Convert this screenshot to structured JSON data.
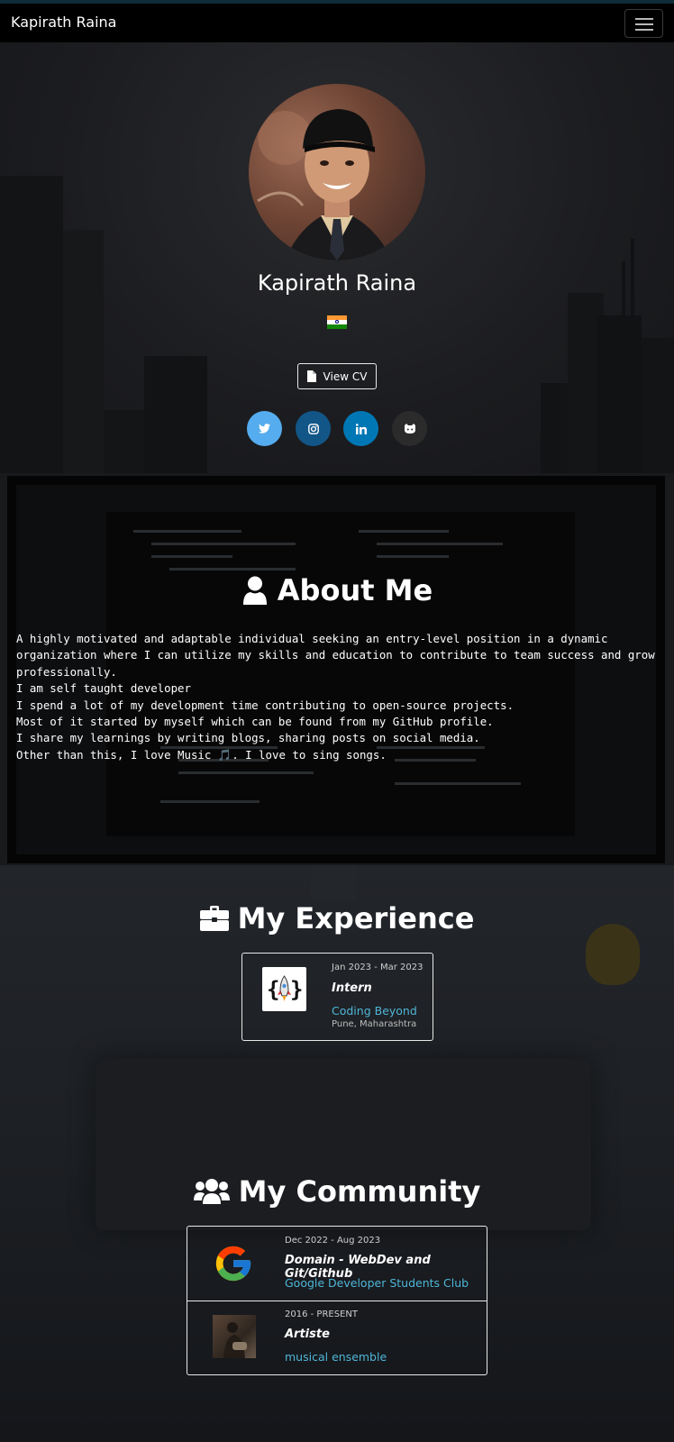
{
  "navbar": {
    "brand": "Kapirath Raina",
    "menu_icon": "hamburger-icon"
  },
  "hero": {
    "name": "Kapirath Raina",
    "flag": "india-flag",
    "cv_button": "View CV",
    "cv_icon": "file-icon",
    "social": [
      {
        "name": "twitter",
        "icon": "twitter-icon",
        "color": "#55acee"
      },
      {
        "name": "instagram",
        "icon": "instagram-icon",
        "color": "#125688"
      },
      {
        "name": "linkedin",
        "icon": "linkedin-icon",
        "color": "#0077b5"
      },
      {
        "name": "github",
        "icon": "github-icon",
        "color": "#2b2b2b"
      }
    ]
  },
  "about": {
    "title_bold": "About",
    "title_light": "Me",
    "title_icon": "user-icon",
    "lines": [
      "A highly motivated and adaptable individual seeking an entry-level position in a dynamic organization where I can utilize my skills and education to contribute to team success and grow professionally.",
      "I am self taught developer",
      "I spend a lot of my development time contributing to open-source projects.",
      "Most of it started by myself which can be found from my GitHub profile.",
      "I share my learnings by writing blogs, sharing posts on social media.",
      "Other than this, I love Music 🎵. I love to sing songs."
    ]
  },
  "experience": {
    "title_light": "My",
    "title_bold": "Experience",
    "title_icon": "briefcase-icon",
    "items": [
      {
        "date": "Jan 2023 - Mar 2023",
        "role": "Intern",
        "org": "Coding Beyond",
        "location": "Pune, Maharashtra",
        "logo": "rocket-braces-icon"
      }
    ]
  },
  "community": {
    "title_light": "My",
    "title_bold": "Community",
    "title_icon": "users-icon",
    "items": [
      {
        "date": "Dec 2022 - Aug 2023",
        "role": "Domain - WebDev and Git/Github",
        "org": "Google Developer Students Club",
        "logo": "google-icon"
      },
      {
        "date": "2016 - PRESENT",
        "role": "Artiste",
        "org": "musical ensemble",
        "logo": "music-photo"
      }
    ]
  },
  "colors": {
    "accent_link": "#4fb6d8",
    "navbar_bg": "#000000"
  }
}
